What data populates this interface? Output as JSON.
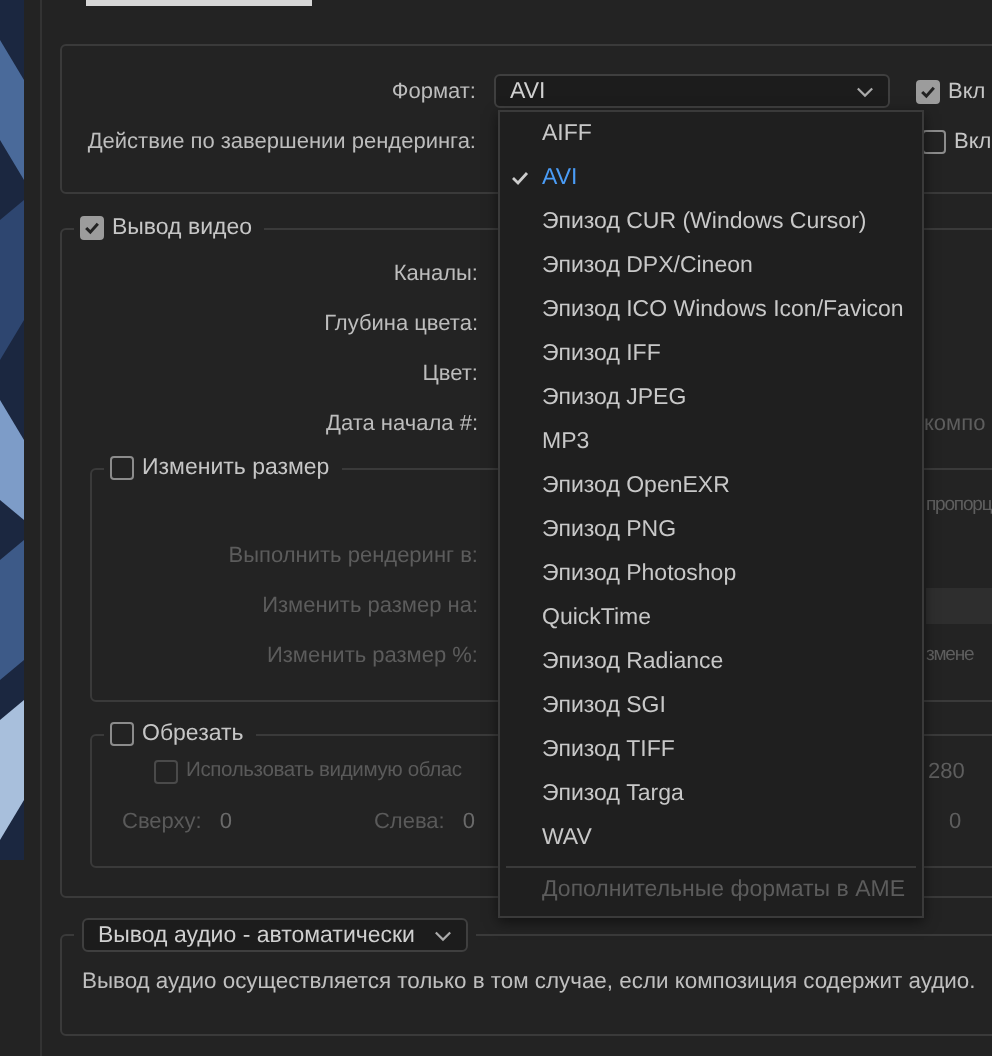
{
  "format": {
    "label": "Формат:",
    "value": "AVI",
    "include": {
      "label": "Вкл",
      "checked": true
    }
  },
  "post_render": {
    "label": "Действие по завершении рендеринга:",
    "include": {
      "label": "Вкл",
      "checked": false
    }
  },
  "video_output": {
    "label": "Вывод видео",
    "checked": true,
    "fields": [
      {
        "label": "Каналы:"
      },
      {
        "label": "Глубина цвета:"
      },
      {
        "label": "Цвет:"
      },
      {
        "label": "Дата начала #:",
        "aside": "компо"
      }
    ]
  },
  "resize": {
    "label": "Изменить размер",
    "checked": false,
    "aside": "пропорц",
    "fields": [
      {
        "label": "Выполнить рендеринг в:",
        "disabled": true
      },
      {
        "label": "Изменить размер на:",
        "disabled": true
      },
      {
        "label": "Изменить размер %:",
        "disabled": true,
        "aside": "змене"
      }
    ]
  },
  "crop": {
    "label": "Обрезать",
    "checked": false,
    "use_visible": {
      "label": "Использовать видимую облас",
      "checked": false,
      "disabled": true
    },
    "aside": "280",
    "edges": [
      {
        "label": "Сверху:",
        "value": "0"
      },
      {
        "label": "Слева:",
        "value": "0"
      }
    ],
    "edges_aside": "0"
  },
  "audio": {
    "value": "Вывод аудио - автоматически",
    "note": "Вывод аудио осуществляется только в том случае, если композиция содержит аудио."
  },
  "format_menu": {
    "items": [
      {
        "label": "AIFF",
        "selected": false
      },
      {
        "label": "AVI",
        "selected": true
      },
      {
        "label": "Эпизод CUR (Windows Cursor)",
        "selected": false
      },
      {
        "label": "Эпизод DPX/Cineon",
        "selected": false
      },
      {
        "label": "Эпизод ICO Windows Icon/Favicon",
        "selected": false
      },
      {
        "label": "Эпизод IFF",
        "selected": false
      },
      {
        "label": "Эпизод JPEG",
        "selected": false
      },
      {
        "label": "MP3",
        "selected": false
      },
      {
        "label": "Эпизод OpenEXR",
        "selected": false
      },
      {
        "label": "Эпизод PNG",
        "selected": false
      },
      {
        "label": "Эпизод Photoshop",
        "selected": false
      },
      {
        "label": "QuickTime",
        "selected": false
      },
      {
        "label": "Эпизод Radiance",
        "selected": false
      },
      {
        "label": "Эпизод SGI",
        "selected": false
      },
      {
        "label": "Эпизод TIFF",
        "selected": false
      },
      {
        "label": "Эпизод Targa",
        "selected": false
      },
      {
        "label": "WAV",
        "selected": false
      }
    ],
    "extra": {
      "label": "Дополнительные форматы в AME",
      "disabled": true
    }
  }
}
